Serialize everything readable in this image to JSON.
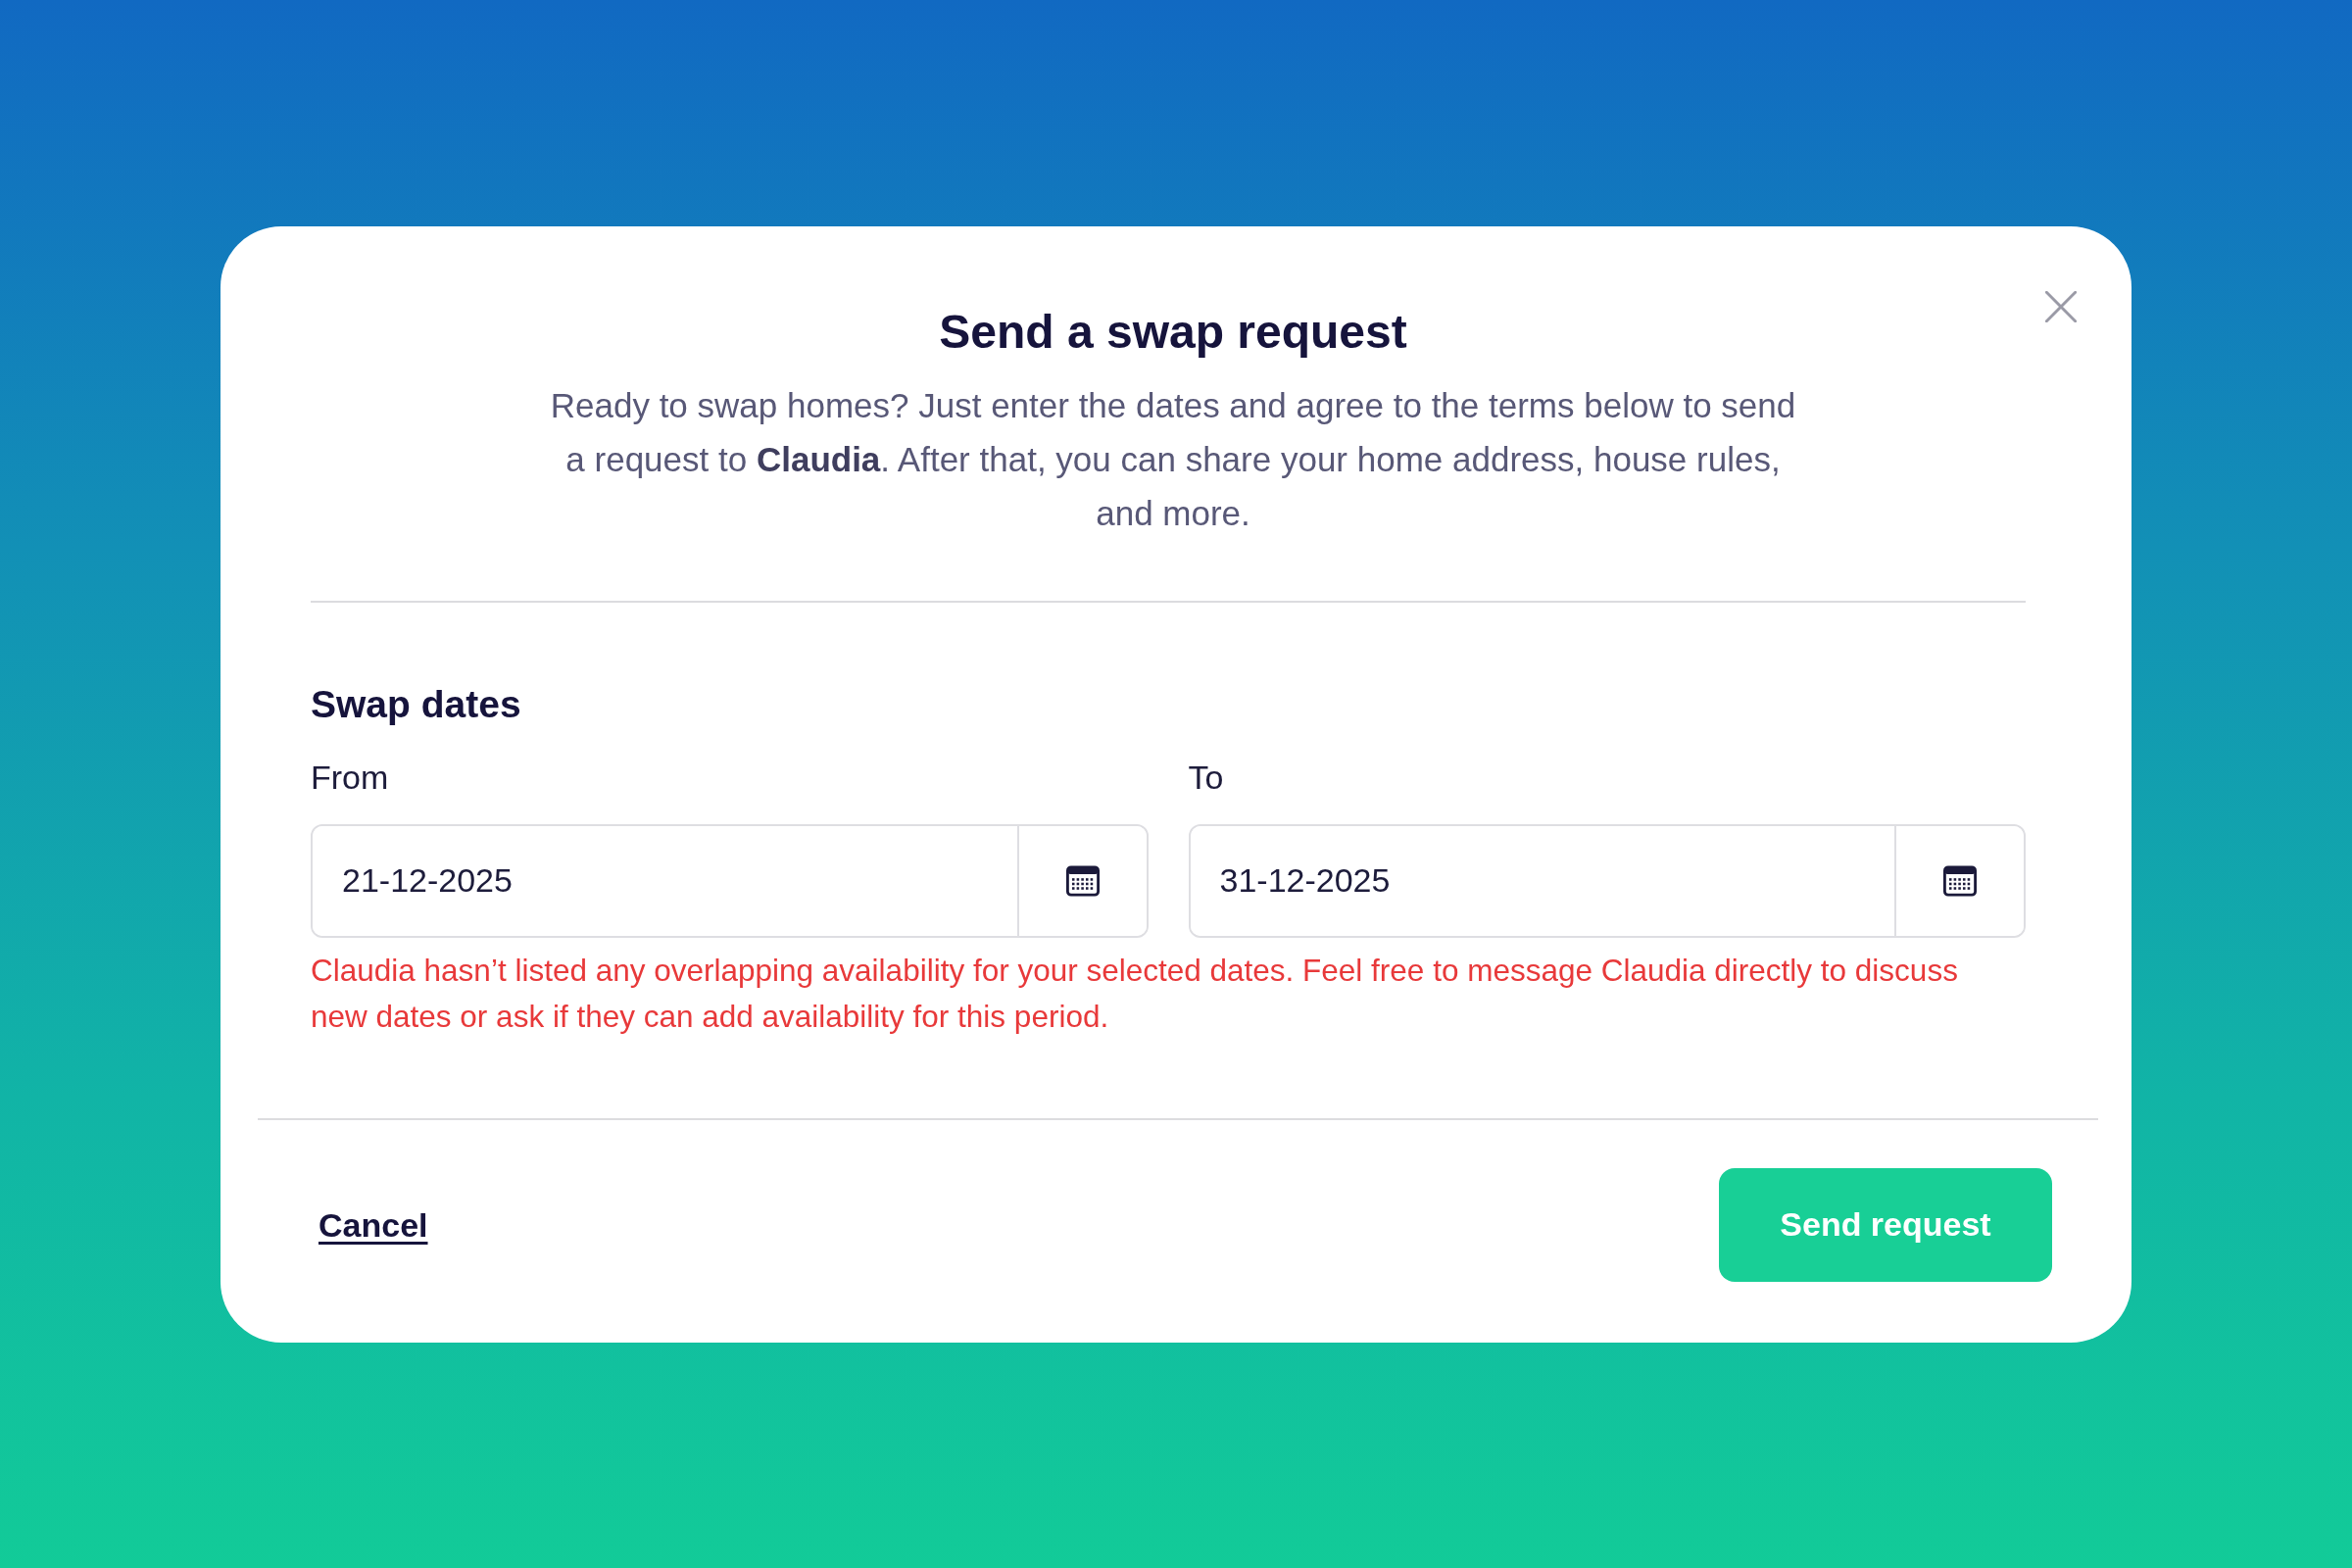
{
  "dialog": {
    "title": "Send a swap request",
    "description": "Ready to swap homes? Just enter the dates and agree to the terms below to send a request to **Claudia**. After that, you can share your home address, house rules, and more.",
    "section": {
      "heading": "Swap dates",
      "fields": [
        {
          "label": "From",
          "value": "21-12-2025"
        },
        {
          "label": "To",
          "value": "31-12-2025"
        }
      ],
      "error": "Claudia hasn’t listed any overlapping availability for your selected dates. Feel free to message Claudia directly to discuss new dates or ask if they can add availability for this period."
    },
    "footer": {
      "cancel": "Cancel",
      "submit": "Send request"
    }
  }
}
